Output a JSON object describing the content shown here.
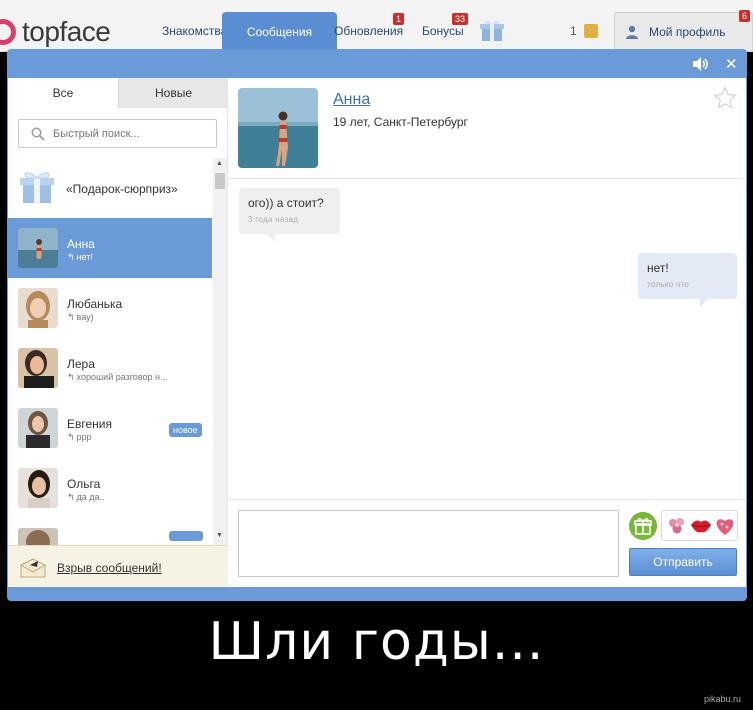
{
  "site": {
    "logo": "topface",
    "nav": {
      "dating": "Знакомства",
      "messages": "Сообщения",
      "updates": "Обновления",
      "updates_count": "1",
      "bonuses": "Бонусы",
      "bonuses_count": "33",
      "coins": "1",
      "profile": "Мой профиль",
      "profile_count": "6"
    }
  },
  "sidebar": {
    "tabs": {
      "all": "Все",
      "new": "Новые"
    },
    "search_placeholder": "Быстрый поиск...",
    "gift_item": "«Подарок-сюрприз»",
    "contacts": [
      {
        "name": "Анна",
        "last": "нет!",
        "active": true
      },
      {
        "name": "Любанька",
        "last": "вау)"
      },
      {
        "name": "Лера",
        "last": "хороший разговор н..."
      },
      {
        "name": "Евгения",
        "last": "ррр",
        "badge": "новое"
      },
      {
        "name": "Ольга",
        "last": "да да.."
      }
    ],
    "bomb_link": "Взрыв сообщений!"
  },
  "chat": {
    "name": "Анна",
    "info": "19 лет, Санкт-Петербург",
    "messages": [
      {
        "text": "ого)) а стоит?",
        "time": "3 года назад",
        "direction": "in"
      },
      {
        "text": "нет!",
        "time": "только что",
        "direction": "out"
      }
    ],
    "send_label": "Отправить"
  },
  "caption": "Шли годы...",
  "watermark": "pikabu.ru",
  "colors": {
    "accent": "#6a9ad8",
    "active_tab": "#5a8dd1",
    "link": "#3e6fb1",
    "badge_red": "#c9302c"
  }
}
